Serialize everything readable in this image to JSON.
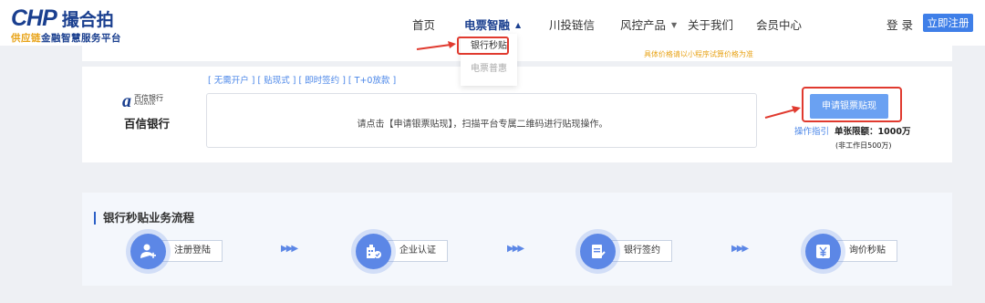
{
  "header": {
    "logo_latin": "CHP",
    "logo_cn": "撮合拍",
    "tagline_highlight": "供应链",
    "tagline_rest": "金融智慧服务平台",
    "nav": [
      {
        "label": "首页",
        "active": false,
        "caret": false
      },
      {
        "label": "电票智融",
        "active": true,
        "caret": true
      },
      {
        "label": "川投链信",
        "active": false,
        "caret": false
      },
      {
        "label": "风控产品",
        "active": false,
        "caret": true
      },
      {
        "label": "关于我们",
        "active": false,
        "caret": false
      },
      {
        "label": "会员中心",
        "active": false,
        "caret": false
      }
    ],
    "login": "登 录",
    "register": "立即注册"
  },
  "dropdown": {
    "items": [
      "银行秒贴",
      "电票普惠"
    ]
  },
  "top_card": {
    "price_note": "具体价格请以小程序试算价格为准"
  },
  "bank_card": {
    "tags": "[ 无需开户 ] [ 贴现式 ] [ 即时签约 ] [ T+0放款 ]",
    "logo_mark": "a",
    "logo_cn_small": "百信银行",
    "logo_en": "AIBANK",
    "bank_name": "百信银行",
    "info": "请点击【申请银票贴现】，扫描平台专属二维码进行贴现操作。",
    "apply_button": "申请银票贴现",
    "guide": "操作指引",
    "limit": "单张限额：1000万",
    "limit_note": "(非工作日500万)"
  },
  "process": {
    "title": "银行秒贴业务流程",
    "steps": [
      {
        "label": "注册登陆",
        "icon": "user-add-icon"
      },
      {
        "label": "企业认证",
        "icon": "company-verify-icon"
      },
      {
        "label": "银行签约",
        "icon": "sign-document-icon"
      },
      {
        "label": "询价秒贴",
        "icon": "yen-quote-icon"
      }
    ],
    "arrow_glyph": "▶▶▶"
  },
  "colors": {
    "brand": "#1a3f8f",
    "accent": "#3f7fe8",
    "highlight_red": "#e03a2f",
    "note_orange": "#e8a317",
    "step_blue": "#5c87e6"
  }
}
